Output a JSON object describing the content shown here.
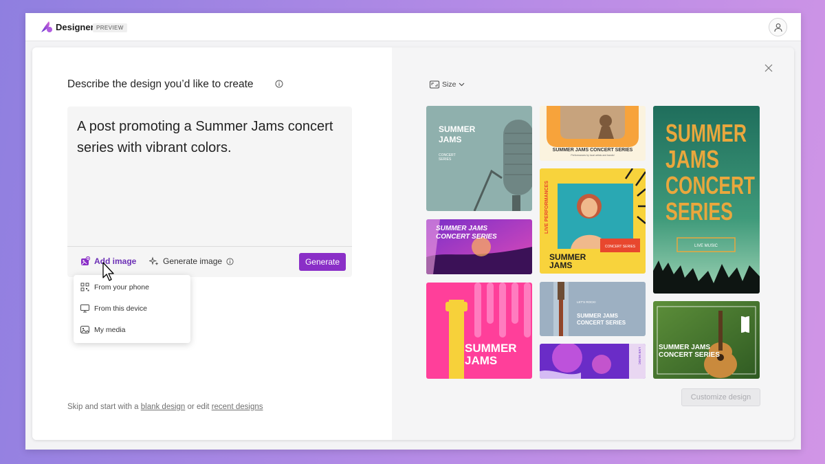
{
  "app": {
    "name": "Designer",
    "badge": "PREVIEW"
  },
  "prompt": {
    "heading": "Describe the design you’d like to create",
    "text": "A post promoting a Summer Jams concert series with vibrant colors."
  },
  "toolbar": {
    "add_image": "Add image",
    "generate_image": "Generate image",
    "generate": "Generate"
  },
  "add_image_menu": [
    {
      "label": "From your phone",
      "icon": "qr-code-icon"
    },
    {
      "label": "From this device",
      "icon": "monitor-icon"
    },
    {
      "label": "My media",
      "icon": "image-icon"
    }
  ],
  "footer": {
    "prefix": "Skip and start with a ",
    "blank_link": "blank design",
    "middle": " or edit ",
    "recent_link": "recent designs"
  },
  "results": {
    "size_label": "Size",
    "customize": "Customize design",
    "designs": [
      {
        "id": "d1",
        "lines": [
          "SUMMER",
          "JAMS",
          "CONCERT",
          "SERIES"
        ]
      },
      {
        "id": "d2",
        "lines": [
          "SUMMER JAMS",
          "CONCERT SERIES"
        ]
      },
      {
        "id": "d3",
        "lines": [
          "SUMMER",
          "JAMS"
        ]
      },
      {
        "id": "d4",
        "lines": [
          "SUMMER JAMS CONCERT SERIES",
          "Performances by local artists and bands!"
        ]
      },
      {
        "id": "d5",
        "lines": [
          "LIVE PERFORMANCES",
          "CONCERT SERIES",
          "SUMMER",
          "JAMS"
        ]
      },
      {
        "id": "d6",
        "lines": [
          "LET'S ROCK!",
          "SUMMER JAMS",
          "CONCERT SERIES"
        ]
      },
      {
        "id": "d7",
        "lines": [
          "LIVE MUSIC"
        ]
      },
      {
        "id": "d8",
        "lines": [
          "SUMMER",
          "JAMS",
          "CONCERT",
          "SERIES",
          "LIVE MUSIC"
        ]
      },
      {
        "id": "d9",
        "lines": [
          "SUMMER JAMS",
          "CONCERT SERIES"
        ]
      }
    ]
  },
  "colors": {
    "accent": "#8a2fc7",
    "link": "#6b2fb5"
  }
}
